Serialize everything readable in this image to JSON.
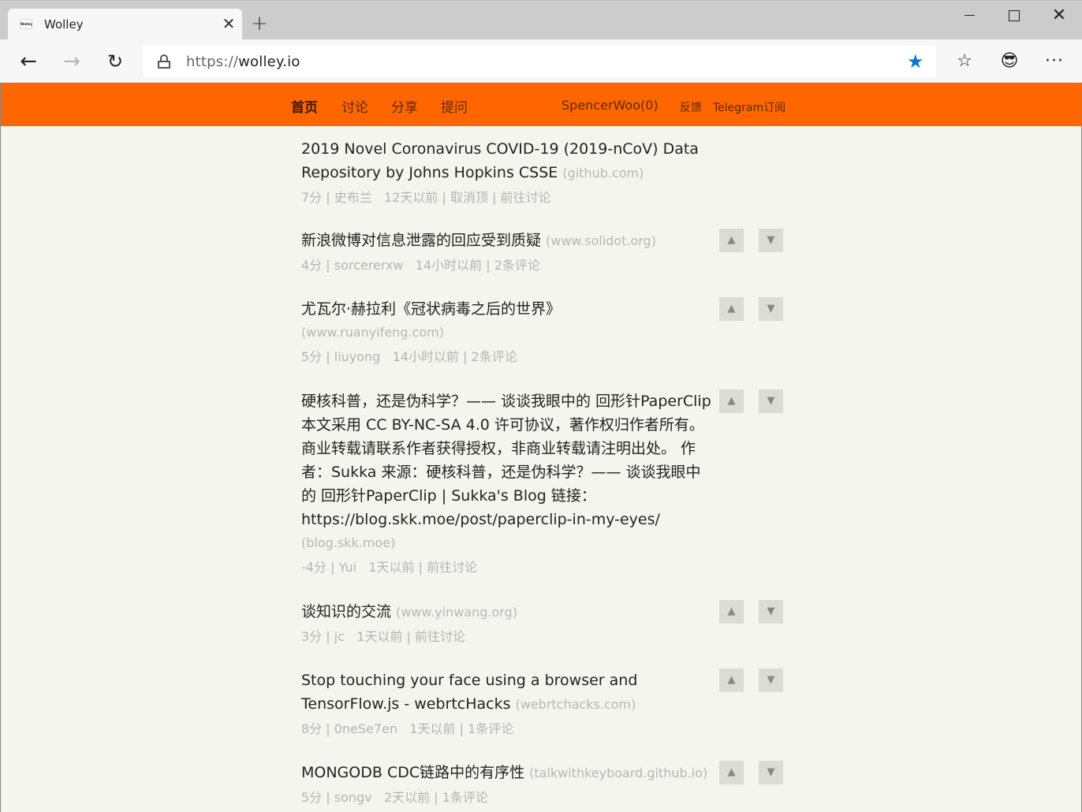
{
  "browser": {
    "tab_favicon_text": "Wolley",
    "tab_title": "Wolley",
    "tab_close": "✕",
    "new_tab": "+",
    "win_close": "✕",
    "url_protocol": "https://",
    "url_host": "wolley.io",
    "icons": {
      "back": "←",
      "forward": "→",
      "reload": "↻",
      "star": "★",
      "favorites": "☆",
      "profile": "😎",
      "more": "···"
    }
  },
  "site_nav": {
    "home": "首页",
    "discuss": "讨论",
    "share": "分享",
    "ask": "提问",
    "user": "SpencerWoo(0)",
    "feedback": "反馈",
    "telegram": "Telegram订阅",
    "brand_color": "#ff6600"
  },
  "posts": [
    {
      "title": "2019 Novel Coronavirus COVID-19 (2019-nCoV) Data Repository by Johns Hopkins CSSE",
      "domain": "(github.com)",
      "score": "7分",
      "author": "史布兰",
      "time": "12天以前",
      "action": "取消顶",
      "comments": "前往讨论"
    },
    {
      "title": "新浪微博对信息泄露的回应受到质疑",
      "domain": "(www.solidot.org)",
      "score": "4分",
      "author": "sorcererxw",
      "time": "14小时以前",
      "comments": "2条评论"
    },
    {
      "title": "尤瓦尔·赫拉利《冠状病毒之后的世界》",
      "domain": "(www.ruanyifeng.com)",
      "score": "5分",
      "author": "liuyong",
      "time": "14小时以前",
      "comments": "2条评论"
    },
    {
      "title": "硬核科普，还是伪科学？—— 谈谈我眼中的 回形针PaperClip 本文采用 CC BY-NC-SA 4.0 许可协议，著作权归作者所有。商业转载请联系作者获得授权，非商业转载请注明出处。 作者：Sukka 来源：硬核科普，还是伪科学？—— 谈谈我眼中的 回形针PaperClip | Sukka's Blog 链接：https://blog.skk.moe/post/paperclip-in-my-eyes/",
      "domain": "(blog.skk.moe)",
      "score": "-4分",
      "author": "Yui",
      "time": "1天以前",
      "comments": "前往讨论"
    },
    {
      "title": "谈知识的交流",
      "domain": "(www.yinwang.org)",
      "score": "3分",
      "author": "jc",
      "time": "1天以前",
      "comments": "前往讨论"
    },
    {
      "title": "Stop touching your face using a browser and TensorFlow.js - webrtcHacks",
      "domain": "(webrtchacks.com)",
      "score": "8分",
      "author": "0neSe7en",
      "time": "1天以前",
      "comments": "1条评论"
    },
    {
      "title": "MONGODB CDC链路中的有序性",
      "domain": "(talkwithkeyboard.github.io)",
      "score": "5分",
      "author": "songv",
      "time": "2天以前",
      "comments": "1条评论"
    }
  ],
  "vote": {
    "up": "▲",
    "down": "▼"
  }
}
